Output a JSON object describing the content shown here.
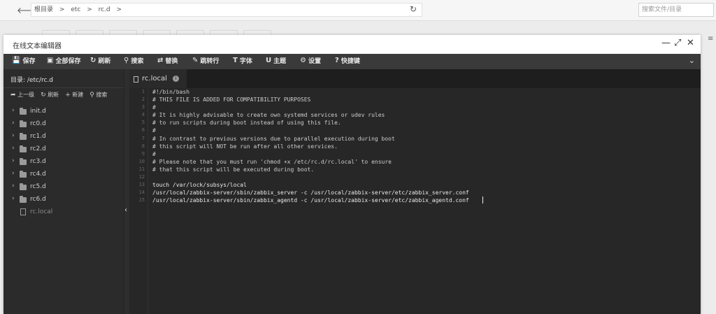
{
  "topbar": {
    "back_icon": "back-arrow-icon",
    "crumbs": [
      "根目录",
      ">",
      "etc",
      ">",
      "rc.d",
      ">"
    ],
    "search_placeholder": "搜索文件/目录"
  },
  "window": {
    "title": "在线文本编辑器",
    "minimize": "—",
    "maximize": "⤢",
    "close": "✕"
  },
  "toolbar": {
    "items": [
      {
        "icon": "save-icon",
        "glyph": "💾",
        "label": "保存"
      },
      {
        "icon": "save-all-icon",
        "glyph": "▣",
        "label": "全部保存"
      },
      {
        "icon": "refresh-icon",
        "glyph": "↻",
        "label": "刷新"
      },
      {
        "icon": "search-icon",
        "glyph": "⚲",
        "label": "搜索"
      },
      {
        "icon": "replace-icon",
        "glyph": "⇄",
        "label": "替换"
      },
      {
        "icon": "goto-line-icon",
        "glyph": "✎",
        "label": "跳转行"
      },
      {
        "icon": "font-icon",
        "glyph": "T",
        "label": "字体"
      },
      {
        "icon": "theme-icon",
        "glyph": "U",
        "label": "主题"
      },
      {
        "icon": "settings-icon",
        "glyph": "⚙",
        "label": "设置"
      },
      {
        "icon": "shortcut-icon",
        "glyph": "?",
        "label": "快捷键"
      }
    ],
    "collapse_glyph": "⌄"
  },
  "sidebar": {
    "directory_label": "目录: /etc/rc.d",
    "actions": [
      {
        "glyph": "➦",
        "label": "上一级"
      },
      {
        "glyph": "↻",
        "label": "刷新"
      },
      {
        "glyph": "+",
        "label": "新建"
      },
      {
        "glyph": "⚲",
        "label": "搜索"
      }
    ],
    "tree": [
      {
        "type": "folder",
        "name": "init.d"
      },
      {
        "type": "folder",
        "name": "rc0.d"
      },
      {
        "type": "folder",
        "name": "rc1.d"
      },
      {
        "type": "folder",
        "name": "rc2.d"
      },
      {
        "type": "folder",
        "name": "rc3.d"
      },
      {
        "type": "folder",
        "name": "rc4.d"
      },
      {
        "type": "folder",
        "name": "rc5.d"
      },
      {
        "type": "folder",
        "name": "rc6.d"
      },
      {
        "type": "file",
        "name": "rc.local"
      }
    ]
  },
  "editor": {
    "tab_label": "rc.local",
    "lines": [
      {
        "n": "1",
        "text": "#!/bin/bash"
      },
      {
        "n": "2",
        "text": "# THIS FILE IS ADDED FOR COMPATIBILITY PURPOSES"
      },
      {
        "n": "3",
        "text": "#"
      },
      {
        "n": "4",
        "text": "# It is highly advisable to create own systemd services or udev rules"
      },
      {
        "n": "5",
        "text": "# to run scripts during boot instead of using this file."
      },
      {
        "n": "6",
        "text": "#"
      },
      {
        "n": "7",
        "text": "# In contrast to previous versions due to parallel execution during boot"
      },
      {
        "n": "8",
        "text": "# this script will NOT be run after all other services."
      },
      {
        "n": "9",
        "text": "#"
      },
      {
        "n": "10",
        "text": "# Please note that you must run 'chmod +x /etc/rc.d/rc.local' to ensure"
      },
      {
        "n": "11",
        "text": "# that this script will be executed during boot."
      },
      {
        "n": "12",
        "text": ""
      },
      {
        "n": "13",
        "text": "touch /var/lock/subsys/local"
      },
      {
        "n": "14",
        "text": "/usr/local/zabbix-server/sbin/zabbix_server -c /usr/local/zabbix-server/etc/zabbix_server.conf"
      },
      {
        "n": "15",
        "text": "/usr/local/zabbix-server/sbin/zabbix_agentd -c /usr/local/zabbix-server/etc/zabbix_agentd.conf"
      }
    ]
  }
}
